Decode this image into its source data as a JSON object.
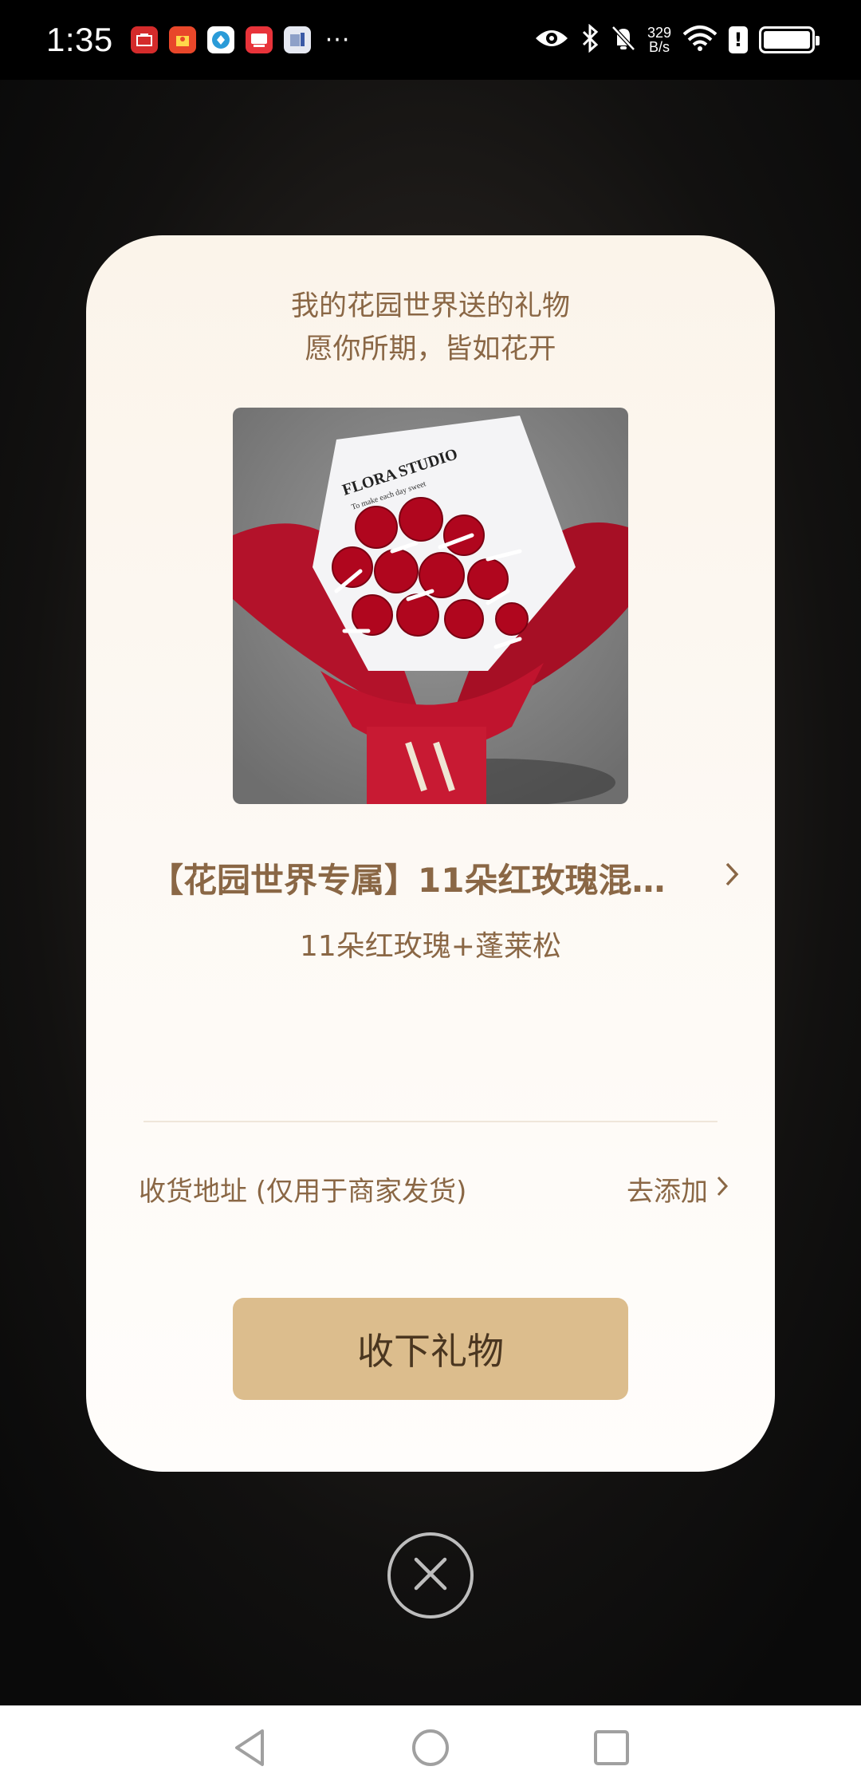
{
  "status_bar": {
    "time": "1:35",
    "app_icons": [
      "huawei-app-icon",
      "shopping-app-icon",
      "browser-app-icon",
      "video-app-icon",
      "files-app-icon"
    ],
    "more": "···",
    "net_speed_value": "329",
    "net_speed_unit": "B/s",
    "status_icons": [
      "eye-icon",
      "bluetooth-icon",
      "mute-icon",
      "wifi-icon",
      "alert-icon",
      "battery-icon"
    ]
  },
  "card": {
    "header_line1": "我的花园世界送的礼物",
    "header_line2": "愿你所期，皆如花开",
    "product_image_text": "FLORA STUDIO",
    "product_image_subtext": "To make each day sweet",
    "product_title": "【花园世界专属】11朵红玫瑰混…",
    "product_subtitle": "11朵红玫瑰+蓬莱松",
    "address_label": "收货地址 (仅用于商家发货)",
    "address_action": "去添加",
    "accept_button": "收下礼物"
  },
  "colors": {
    "accent_text": "#8a6745",
    "button_bg": "#dcbd8d",
    "card_bg": "#fdf9f4"
  },
  "nav": {
    "icons": [
      "back-icon",
      "home-icon",
      "recents-icon"
    ]
  }
}
